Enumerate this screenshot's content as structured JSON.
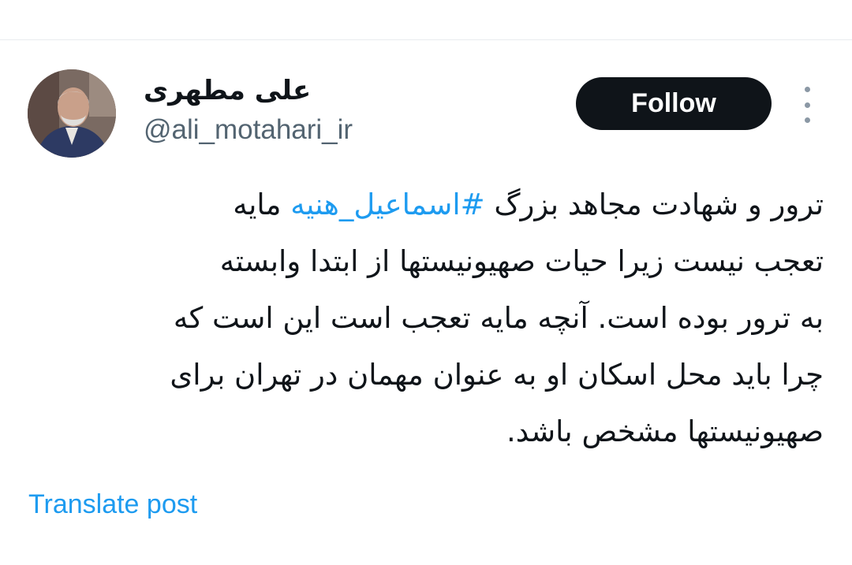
{
  "author": {
    "display_name": "علی مطهری",
    "handle": "@ali_motahari_ir",
    "avatar_icon": "profile-photo"
  },
  "follow_button": {
    "label": "Follow"
  },
  "more_menu": {
    "icon": "more-vertical-icon"
  },
  "tweet": {
    "line1_before": "ترور و شهادت مجاهد بزرگ ",
    "line1_hashtag": "#اسماعیل_هنیه",
    "line1_after": " مایه",
    "line2": "تعجب نیست زیرا حیات صهیونیستها از ابتدا وابسته",
    "line3": "به ترور بوده است. آنچه مایه تعجب است این است که",
    "line4": "چرا باید محل اسکان او به عنوان مهمان در تهران برای",
    "line5": "صهیونیستها مشخص باشد."
  },
  "translate_link": {
    "label": "Translate post"
  },
  "colors": {
    "accent": "#1d9bf0",
    "button_bg": "#0f1419",
    "muted": "#536471"
  }
}
